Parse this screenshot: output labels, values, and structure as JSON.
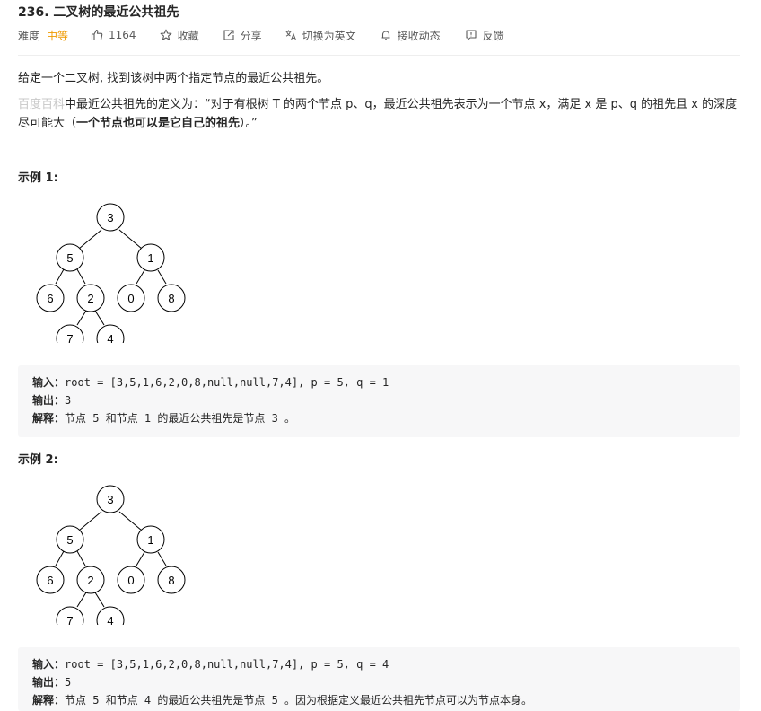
{
  "problem": {
    "title": "236. 二叉树的最近公共祖先"
  },
  "meta": {
    "difficulty_label": "难度",
    "difficulty": "中等",
    "likes": "1164",
    "favorite": "收藏",
    "share": "分享",
    "switch_lang": "切换为英文",
    "subscribe": "接收动态",
    "feedback": "反馈"
  },
  "colors": {
    "difficulty": "#ef9a00",
    "link": "#c8c8c8",
    "code_bg": "#f7f7f8"
  },
  "description": {
    "line1": "给定一个二叉树, 找到该树中两个指定节点的最近公共祖先。",
    "link": "百度百科",
    "def_part1": "中最近公共祖先的定义为：“对于有根树 T 的两个节点 p、q，最近公共祖先表示为一个节点 x，满足 x 是 p、q 的祖先且 x 的深度尽可能大（",
    "def_bold": "一个节点也可以是它自己的祖先",
    "def_part2": "）。”"
  },
  "tree": {
    "nodes": [
      "3",
      "5",
      "1",
      "6",
      "2",
      "0",
      "8",
      "7",
      "4"
    ]
  },
  "examples": [
    {
      "title": "示例 1:",
      "input_label": "输入：",
      "input": "root = [3,5,1,6,2,0,8,null,null,7,4], p = 5, q = 1",
      "output_label": "输出：",
      "output": "3",
      "explain_label": "解释：",
      "explain": "节点 5 和节点 1 的最近公共祖先是节点 3 。"
    },
    {
      "title": "示例 2:",
      "input_label": "输入：",
      "input": "root = [3,5,1,6,2,0,8,null,null,7,4], p = 5, q = 4",
      "output_label": "输出：",
      "output": "5",
      "explain_label": "解释：",
      "explain": "节点 5 和节点 4 的最近公共祖先是节点 5 。因为根据定义最近公共祖先节点可以为节点本身。"
    }
  ]
}
